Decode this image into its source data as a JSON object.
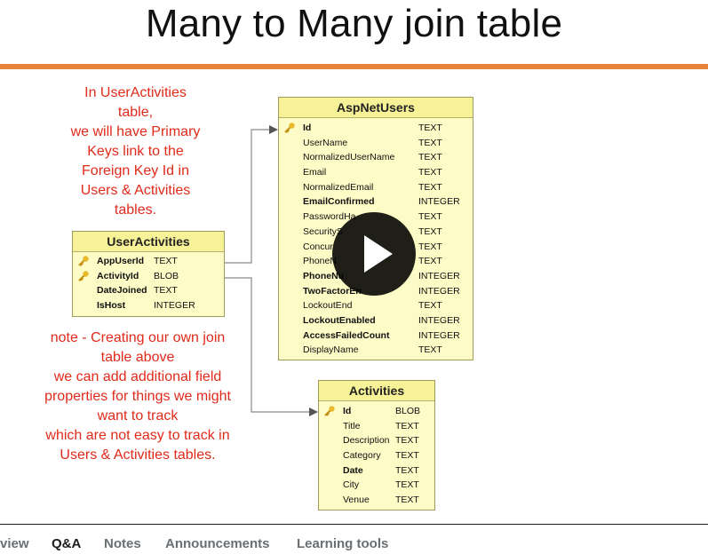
{
  "slide": {
    "title": "Many to Many join table",
    "note_top": [
      "In UserActivities",
      "table,",
      "we will have Primary",
      "Keys link to the",
      "Foreign Key Id in",
      "Users & Activities",
      "tables."
    ],
    "note_bottom": [
      "note - Creating our own join",
      "table above",
      "we can add additional field",
      "properties for things we might",
      "want to track",
      "which are not easy to track in",
      "Users & Activities tables."
    ],
    "user_activities": {
      "title": "UserActivities",
      "rows": [
        {
          "name": "AppUserId",
          "type": "TEXT"
        },
        {
          "name": "ActivityId",
          "type": "BLOB"
        },
        {
          "name": "DateJoined",
          "type": "TEXT"
        },
        {
          "name": "IsHost",
          "type": "INTEGER"
        }
      ]
    },
    "asp_net_users": {
      "title": "AspNetUsers",
      "rows": [
        {
          "name": "Id",
          "type": "TEXT"
        },
        {
          "name": "UserName",
          "type": "TEXT"
        },
        {
          "name": "NormalizedUserName",
          "type": "TEXT"
        },
        {
          "name": "Email",
          "type": "TEXT"
        },
        {
          "name": "NormalizedEmail",
          "type": "TEXT"
        },
        {
          "name": "EmailConfirmed",
          "type": "INTEGER"
        },
        {
          "name": "PasswordHa",
          "type": "TEXT"
        },
        {
          "name": "SecurityS",
          "type": "TEXT"
        },
        {
          "name": "Concur",
          "type": "TEXT"
        },
        {
          "name": "PhoneN",
          "type": "TEXT"
        },
        {
          "name": "PhoneNu",
          "type": "INTEGER"
        },
        {
          "name": "TwoFactorEn",
          "type": "INTEGER"
        },
        {
          "name": "LockoutEnd",
          "type": "TEXT"
        },
        {
          "name": "LockoutEnabled",
          "type": "INTEGER"
        },
        {
          "name": "AccessFailedCount",
          "type": "INTEGER"
        },
        {
          "name": "DisplayName",
          "type": "TEXT"
        }
      ]
    },
    "activities": {
      "title": "Activities",
      "rows": [
        {
          "name": "Id",
          "type": "BLOB"
        },
        {
          "name": "Title",
          "type": "TEXT"
        },
        {
          "name": "Description",
          "type": "TEXT"
        },
        {
          "name": "Category",
          "type": "TEXT"
        },
        {
          "name": "Date",
          "type": "TEXT"
        },
        {
          "name": "City",
          "type": "TEXT"
        },
        {
          "name": "Venue",
          "type": "TEXT"
        }
      ]
    }
  },
  "tabs": [
    "view",
    "Q&A",
    "Notes",
    "Announcements",
    "Learning tools"
  ],
  "active_tab": "Q&A",
  "colors": {
    "accent": "#e8813a",
    "note": "#e02a1a",
    "table_bg": "#fdfbc6",
    "table_head": "#f7f297"
  }
}
